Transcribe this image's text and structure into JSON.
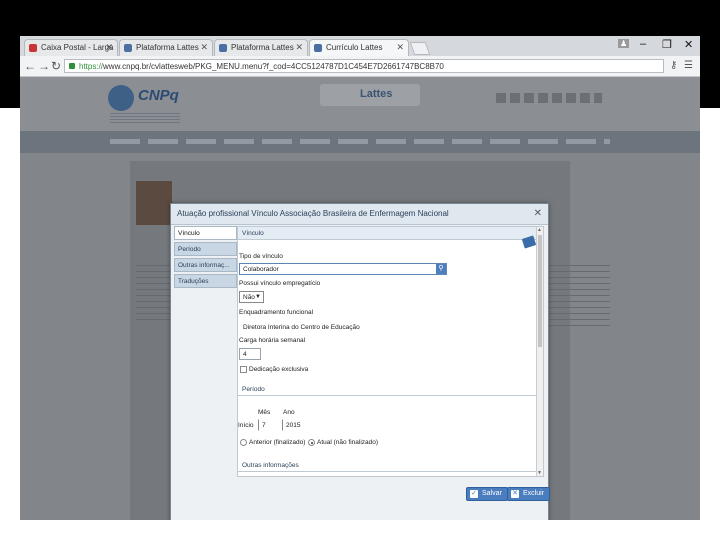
{
  "browser": {
    "tabs": [
      {
        "label": "Caixa Postal - Larga",
        "active": false
      },
      {
        "label": "Plataforma Lattes",
        "active": false
      },
      {
        "label": "Plataforma Lattes",
        "active": false
      },
      {
        "label": "Currículo Lattes",
        "active": true
      }
    ],
    "url_scheme": "https://",
    "url_rest": "www.cnpq.br/cvlattesweb/PKG_MENU.menu?f_cod=4CC5124787D1C454E7D2661747BC8B70",
    "window_controls": {
      "user": "♟",
      "minimize": "–",
      "restore": "❐",
      "close": "✕"
    }
  },
  "site": {
    "logo_text": "CNPq",
    "lattes_label": "Lattes"
  },
  "modal": {
    "title": "Atuação profissional  Vínculo  Associação Brasileira de Enfermagem Nacional",
    "close": "✕",
    "sidebar": [
      {
        "label": "Vínculo",
        "active": true
      },
      {
        "label": "Período",
        "active": false
      },
      {
        "label": "Outras informaç...",
        "active": false
      },
      {
        "label": "Traduções",
        "active": false
      }
    ],
    "section_vinculo": "Vínculo",
    "tipo_label": "Tipo de vínculo",
    "tipo_value": "Colaborador",
    "empregaticio_label": "Possui vínculo empregatício",
    "empregaticio_value": "Não",
    "enquadramento_label": "Enquadramento funcional",
    "enquadramento_value": "Diretora Interina do Centro de Educação",
    "carga_label": "Carga horária semanal",
    "carga_value": "4",
    "dedicacao_label": "Dedicação exclusiva",
    "section_periodo": "Período",
    "mes_label": "Mês",
    "ano_label": "Ano",
    "inicio_label": "Início",
    "mes_value": "7",
    "ano_value": "2015",
    "anterior_label": "Anterior (finalizado)",
    "atual_label": "Atual (não finalizado)",
    "section_outras": "Outras informações",
    "save_label": "Salvar",
    "delete_label": "Excluir"
  }
}
